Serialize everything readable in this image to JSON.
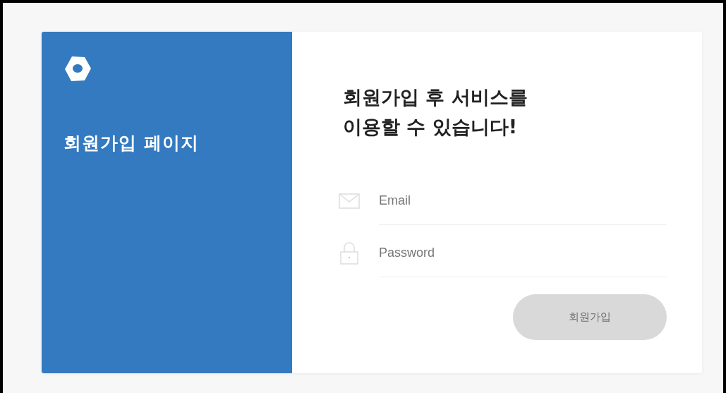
{
  "sidebar": {
    "title": "회원가입 페이지"
  },
  "form": {
    "heading_lines": [
      "회원가입 후 서비스를",
      "이용할 수 있습니다!"
    ],
    "fields": [
      {
        "kind": "email",
        "placeholder": "Email"
      },
      {
        "kind": "password",
        "placeholder": "Password"
      }
    ],
    "submit": {
      "label": "회원가입",
      "disabled": true
    }
  }
}
